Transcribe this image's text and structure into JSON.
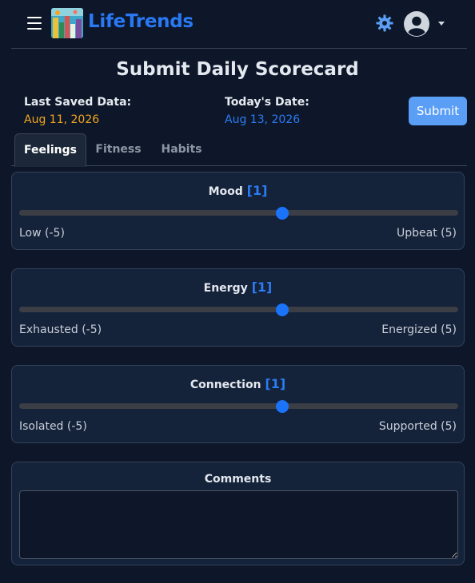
{
  "header": {
    "brand": "LifeTrends",
    "icons": {
      "menu": "hamburger-menu-icon",
      "logo": "app-logo-icon",
      "theme": "gear-icon",
      "account": "user-avatar-icon",
      "dropdown": "caret-down-icon"
    },
    "colors": {
      "brand": "#2979f5",
      "theme_icon": "#5a9ef6"
    }
  },
  "page": {
    "title": "Submit Daily Scorecard",
    "last_saved_label": "Last Saved Data:",
    "last_saved_value": "Aug 11, 2026",
    "today_label": "Today's Date:",
    "today_value": "Aug 13, 2026",
    "submit_label": "Submit"
  },
  "tabs": [
    {
      "label": "Feelings",
      "active": true
    },
    {
      "label": "Fitness",
      "active": false
    },
    {
      "label": "Habits",
      "active": false
    }
  ],
  "sliders": [
    {
      "title": "Mood",
      "value_text": "[1]",
      "value": 1,
      "min": -5,
      "max": 5,
      "low_label": "Low (-5)",
      "high_label": "Upbeat (5)"
    },
    {
      "title": "Energy",
      "value_text": "[1]",
      "value": 1,
      "min": -5,
      "max": 5,
      "low_label": "Exhausted (-5)",
      "high_label": "Energized (5)"
    },
    {
      "title": "Connection",
      "value_text": "[1]",
      "value": 1,
      "min": -5,
      "max": 5,
      "low_label": "Isolated (-5)",
      "high_label": "Supported (5)"
    }
  ],
  "comments": {
    "title": "Comments",
    "value": ""
  },
  "colors": {
    "background": "#0d1729",
    "card": "#14223a",
    "accent": "#2b7cf3",
    "saved_date": "#f0a520",
    "submit_button": "#5a9ef6",
    "slider_thumb": "#1a73f8"
  }
}
